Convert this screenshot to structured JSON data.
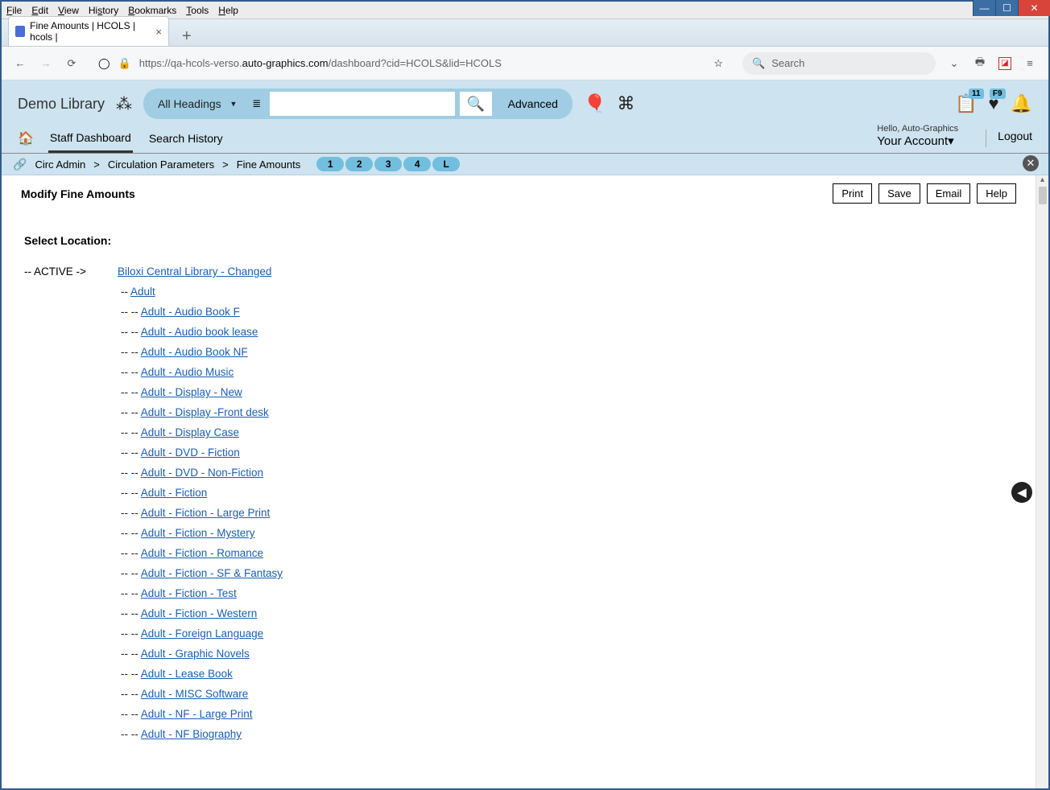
{
  "browser": {
    "menus": [
      "File",
      "Edit",
      "View",
      "History",
      "Bookmarks",
      "Tools",
      "Help"
    ],
    "tab_title": "Fine Amounts | HCOLS | hcols |",
    "url_prefix": "https://qa-hcols-verso.",
    "url_dark": "auto-graphics.com",
    "url_suffix": "/dashboard?cid=HCOLS&lid=HCOLS",
    "search_placeholder": "Search"
  },
  "app": {
    "brand": "Demo Library",
    "headings_label": "All Headings",
    "advanced_label": "Advanced",
    "badge_list": "11",
    "badge_heart": "F9",
    "hello": "Hello, Auto-Graphics",
    "account": "Your Account",
    "logout": "Logout",
    "nav": {
      "staff": "Staff Dashboard",
      "history": "Search History"
    }
  },
  "breadcrumb": {
    "a": "Circ Admin",
    "b": "Circulation Parameters",
    "c": "Fine Amounts",
    "steps": [
      "1",
      "2",
      "3",
      "4",
      "L"
    ]
  },
  "page": {
    "title": "Modify Fine Amounts",
    "buttons": {
      "print": "Print",
      "save": "Save",
      "email": "Email",
      "help": "Help"
    },
    "select_location": "Select Location:",
    "active_marker": "-- ACTIVE ->",
    "root_location": "Biloxi Central Library - Changed",
    "level1_prefix": "--  ",
    "level2_prefix": "--  --  ",
    "items_l1": [
      "Adult"
    ],
    "items_l2": [
      "Adult - Audio Book F",
      "Adult - Audio book lease",
      "Adult - Audio Book NF",
      "Adult - Audio Music",
      "Adult - Display - New",
      "Adult - Display -Front desk",
      "Adult - Display Case",
      "Adult - DVD - Fiction",
      "Adult - DVD - Non-Fiction",
      "Adult - Fiction",
      "Adult - Fiction - Large Print",
      "Adult - Fiction - Mystery",
      "Adult - Fiction - Romance",
      "Adult - Fiction - SF & Fantasy",
      "Adult - Fiction - Test",
      "Adult - Fiction - Western",
      "Adult - Foreign Language",
      "Adult - Graphic Novels",
      "Adult - Lease Book",
      "Adult - MISC Software",
      "Adult - NF - Large Print",
      "Adult - NF Biography"
    ]
  }
}
